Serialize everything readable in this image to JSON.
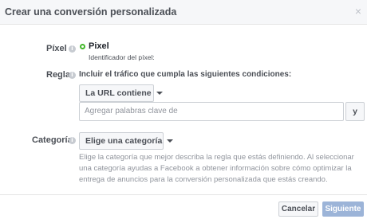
{
  "dialog": {
    "title": "Crear una conversión personalizada",
    "close_icon": "close-icon"
  },
  "pixel": {
    "label": "Píxel",
    "name": "Pixel",
    "id_label": "Identificador del píxel:",
    "status_color": "#42b72a"
  },
  "rule": {
    "label": "Regla",
    "description": "Incluir el tráfico que cumpla las siguientes condiciones:",
    "condition_select": "La URL contiene",
    "keyword_placeholder": "Agregar palabras clave de",
    "and_button": "y"
  },
  "category": {
    "label": "Categoría",
    "select_label": "Elige una categoría",
    "help_text": "Elige la categoría que mejor describa la regla que estás definiendo. Al seleccionar una categoría ayudas a Facebook a obtener información sobre cómo optimizar la entrega de anuncios para la conversión personalizada que estás creando."
  },
  "footer": {
    "cancel": "Cancelar",
    "continue": "Siguiente"
  }
}
